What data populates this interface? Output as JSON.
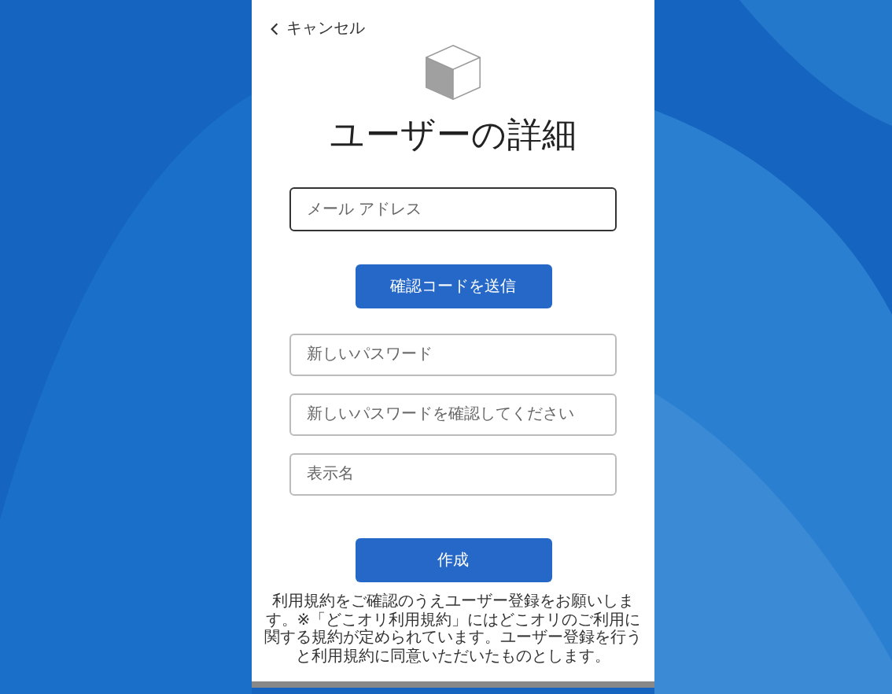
{
  "cancel": {
    "label": "キャンセル"
  },
  "title": "ユーザーの詳細",
  "email_field": {
    "placeholder": "メール アドレス",
    "focused": true
  },
  "send_code_button": "確認コードを送信",
  "fields": [
    {
      "placeholder": "新しいパスワード",
      "focused": false
    },
    {
      "placeholder": "新しいパスワードを確認してください",
      "focused": false
    },
    {
      "placeholder": "表示名",
      "focused": false
    }
  ],
  "create_button": "作成",
  "notice": "利用規約をご確認のうえユーザー登録をお願いします。※「どこオリ利用規約」にはどこオリのご利用に関する規約が定められています。ユーザー登録を行うと利用規約に同意いただいたものとします。"
}
